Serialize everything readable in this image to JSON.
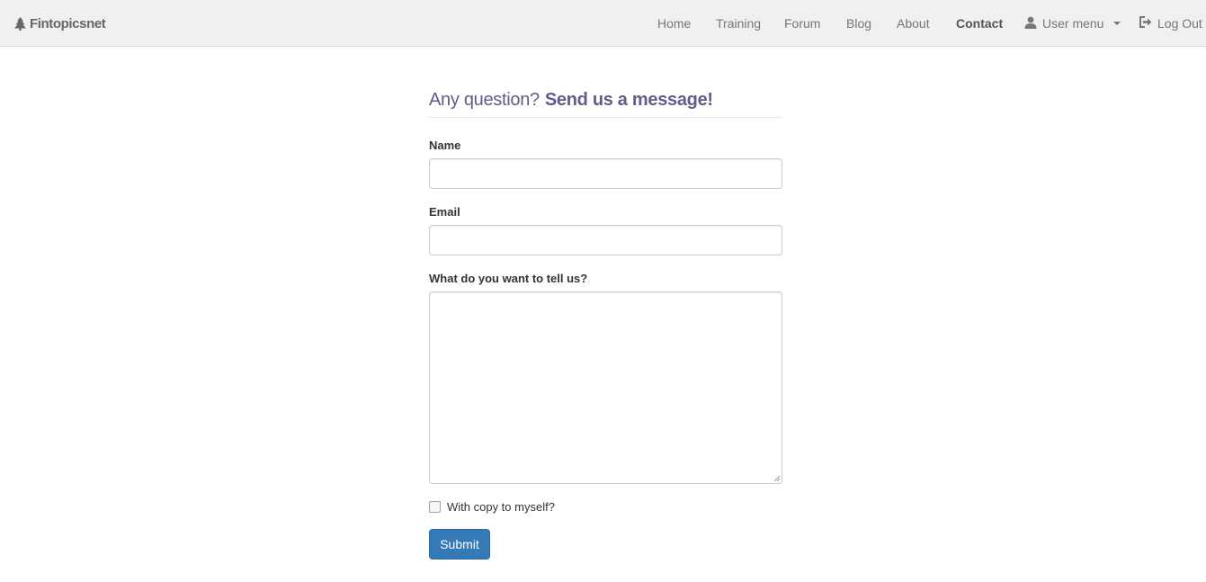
{
  "navbar": {
    "brand": {
      "name": "Fintopicsnet",
      "icon": "tree-icon"
    },
    "links": {
      "home": "Home",
      "training": "Training",
      "forum": "Forum",
      "blog": "Blog",
      "about": "About",
      "contact": "Contact",
      "user_menu": "User menu",
      "log_out": "Log Out"
    },
    "active": "Contact",
    "icons": {
      "user": "user-icon",
      "user_menu_caret": "caret-down-icon",
      "log_out": "log-out-icon"
    }
  },
  "form": {
    "heading": {
      "question": "Any question?",
      "cta": "Send us a message!"
    },
    "name": {
      "label": "Name",
      "value": ""
    },
    "email": {
      "label": "Email",
      "value": ""
    },
    "message": {
      "label": "What do you want to tell us?",
      "value": ""
    },
    "copy_to_self": {
      "label": "With copy to myself?",
      "checked": false
    },
    "submit_label": "Submit"
  },
  "colors": {
    "heading": "#5e5e8a",
    "primary_button": "#337ab7",
    "navbar_bg": "#f0f0f0"
  }
}
